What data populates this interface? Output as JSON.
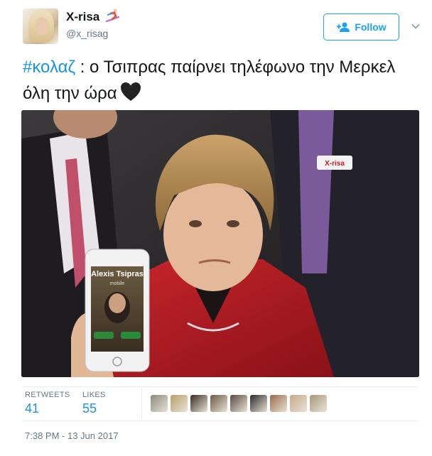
{
  "author": {
    "display_name": "X-risa",
    "handle": "@x_risag",
    "name_emoji": "skier-emoji",
    "avatar_icon": "profile-avatar"
  },
  "follow_button": {
    "label": "Follow",
    "icon": "add-person-icon",
    "color": "#1da1f2"
  },
  "menu": {
    "icon": "chevron-down-icon"
  },
  "tweet": {
    "hashtag": "#κολαζ",
    "text_after_hashtag": " : ο Τσιπρας παίρνει τηλέφωνο την Μερκελ όλη την ώρα",
    "emoji": "black-heart-emoji"
  },
  "photo": {
    "phone_caller_name": "Alexis Tsipras",
    "phone_caller_sub": "mobile",
    "badge_text": "X-risa"
  },
  "stats": {
    "retweets_label": "RETWEETS",
    "retweets_value": "41",
    "likes_label": "LIKES",
    "likes_value": "55"
  },
  "likers": [
    {
      "color": "#8a8a7a"
    },
    {
      "color": "#b8a06a"
    },
    {
      "color": "#3a2c24"
    },
    {
      "color": "#6a5a40"
    },
    {
      "color": "#5a4a3e"
    },
    {
      "color": "#2a2a2a"
    },
    {
      "color": "#9a6a4a"
    },
    {
      "color": "#c8a888"
    },
    {
      "color": "#a89878"
    }
  ],
  "timestamp": "7:38 PM - 13 Jun 2017"
}
